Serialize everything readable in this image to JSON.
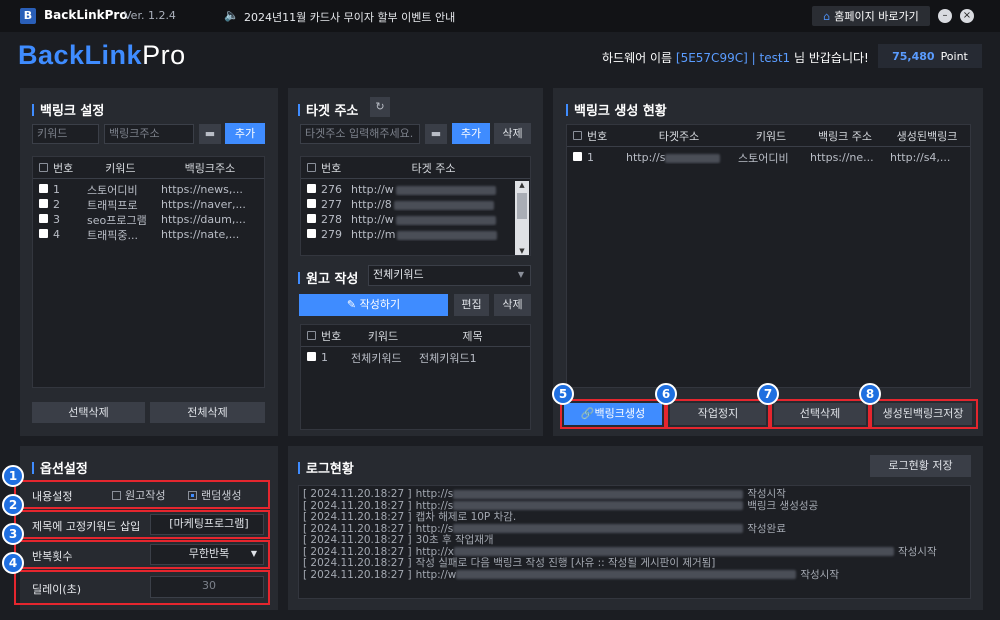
{
  "app": {
    "name": "BackLinkPro",
    "version": "Ver. 1.2.4",
    "notice": "2024년11월 카드사 무이자 할부 이벤트 안내",
    "home_button": "홈페이지 바로가기",
    "brand_main": "BackLink",
    "brand_sub": "Pro"
  },
  "user": {
    "greet_prefix": "하드웨어 이름",
    "hw_id": "[5E57C99C]",
    "sep": "|",
    "user_id": "test1",
    "greet_suffix": "님 반갑습니다!",
    "points": "75,480",
    "points_unit": "Point"
  },
  "backlink_setting": {
    "title": "백링크 설정",
    "keyword_placeholder": "키워드",
    "url_placeholder": "백링크주소",
    "add_button": "추가",
    "columns": [
      "번호",
      "키워드",
      "백링크주소"
    ],
    "rows": [
      {
        "no": "1",
        "keyword": "스토어디비",
        "url": "https://news,..."
      },
      {
        "no": "2",
        "keyword": "트래픽프로",
        "url": "https://naver,..."
      },
      {
        "no": "3",
        "keyword": "seo프로그램",
        "url": "https://daum,..."
      },
      {
        "no": "4",
        "keyword": "트래픽중...",
        "url": "https://nate,..."
      }
    ],
    "delete_selected": "선택삭제",
    "delete_all": "전체삭제"
  },
  "target": {
    "title": "타겟 주소",
    "placeholder": "타겟주소 입력해주세요.",
    "add_button": "추가",
    "delete_button": "삭제",
    "columns": [
      "번호",
      "타겟 주소"
    ],
    "rows": [
      {
        "no": "276",
        "url": "http://w"
      },
      {
        "no": "277",
        "url": "http://8"
      },
      {
        "no": "278",
        "url": "http://w"
      },
      {
        "no": "279",
        "url": "http://m"
      }
    ]
  },
  "draft": {
    "title": "원고 작성",
    "select_value": "전체키워드",
    "write_button": "작성하기",
    "edit_button": "편집",
    "delete_button": "삭제",
    "columns": [
      "번호",
      "키워드",
      "제목"
    ],
    "rows": [
      {
        "no": "1",
        "keyword": "전체키워드",
        "subject": "전체키워드1"
      }
    ]
  },
  "status": {
    "title": "백링크 생성 현황",
    "columns": [
      "번호",
      "타겟주소",
      "키워드",
      "백링크 주소",
      "생성된백링크"
    ],
    "rows": [
      {
        "no": "1",
        "target": "http://s",
        "keyword": "스토어디비",
        "backlink": "https://ne...",
        "generated": "http://s4,..."
      }
    ],
    "buttons": [
      "백링크생성",
      "작업정지",
      "선택삭제",
      "생성된백링크저장"
    ],
    "badges": [
      "5",
      "6",
      "7",
      "8"
    ]
  },
  "options": {
    "title": "옵션설정",
    "badges": [
      "1",
      "2",
      "3",
      "4"
    ],
    "content_label": "내용설정",
    "radio_draft": "원고작성",
    "radio_random": "랜덤생성",
    "fixed_keyword_label": "제목에 고정키워드 삽입",
    "fixed_keyword_value": "[마케팅프로그램]",
    "repeat_label": "반복횟수",
    "repeat_value": "무한반복",
    "delay_label": "딜레이(초)",
    "delay_value": "30"
  },
  "log": {
    "title": "로그현황",
    "save_button": "로그현황 저장",
    "lines": [
      {
        "ts": "[ 2024.11.20.18:27 ]",
        "pre": "http://s",
        "post": "작성시작"
      },
      {
        "ts": "[ 2024.11.20.18:27 ]",
        "pre": "http://s",
        "post": "백링크 생성성공"
      },
      {
        "ts": "[ 2024.11.20.18:27 ]",
        "pre": "캡차 해제로 10P 차감.",
        "post": ""
      },
      {
        "ts": "[ 2024.11.20.18:27 ]",
        "pre": "http://s",
        "post": "작성완료"
      },
      {
        "ts": "[ 2024.11.20.18:27 ]",
        "pre": "30초 후 작업재개",
        "post": ""
      },
      {
        "ts": "[ 2024.11.20.18:27 ]",
        "pre": "http://x",
        "post": "작성시작"
      },
      {
        "ts": "[ 2024.11.20.18:27 ]",
        "pre": "작성 실패로 다음 백링크 작성 진행 [사유 :: 작성될 게시판이 제거됨]",
        "post": ""
      },
      {
        "ts": "[ 2024.11.20.18:27 ]",
        "pre": "http://w",
        "post": "작성시작"
      }
    ]
  },
  "colors": {
    "accent": "#3f8cff",
    "highlight_box": "#e5262e",
    "badge": "#1f6fe0"
  }
}
